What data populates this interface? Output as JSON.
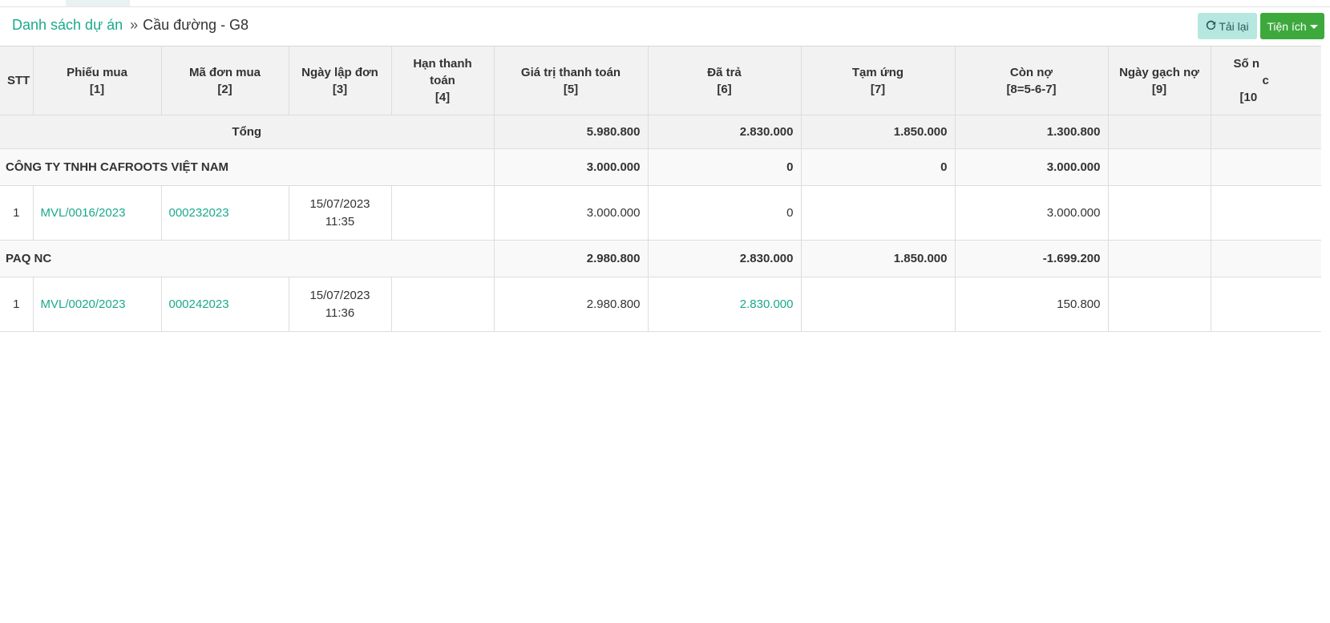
{
  "breadcrumb": {
    "parent": "Danh sách dự án",
    "separator": "»",
    "current": "Cầu đường - G8"
  },
  "toolbar": {
    "reload_label": "Tải lại",
    "utilities_label": "Tiện ích"
  },
  "table": {
    "headers": [
      {
        "title": "STT",
        "sub": ""
      },
      {
        "title": "Phiếu mua",
        "sub": "[1]"
      },
      {
        "title": "Mã đơn mua",
        "sub": "[2]"
      },
      {
        "title": "Ngày lập đơn",
        "sub": "[3]"
      },
      {
        "title": "Hạn thanh toán",
        "sub": "[4]"
      },
      {
        "title": "Giá trị thanh toán",
        "sub": "[5]"
      },
      {
        "title": "Đã trả",
        "sub": "[6]"
      },
      {
        "title": "Tạm ứng",
        "sub": "[7]"
      },
      {
        "title": "Còn nợ",
        "sub": "[8=5-6-7]"
      },
      {
        "title": "Ngày gạch nợ",
        "sub": "[9]"
      },
      {
        "title": "Số n",
        "sub": "c",
        "sub2": "[10"
      }
    ],
    "total": {
      "label": "Tổng",
      "value": "5.980.800",
      "paid": "2.830.000",
      "advance": "1.850.000",
      "debt": "1.300.800"
    },
    "groups": [
      {
        "name": "CÔNG TY TNHH CAFROOTS VIỆT NAM",
        "value": "3.000.000",
        "paid": "0",
        "advance": "0",
        "debt": "3.000.000",
        "rows": [
          {
            "stt": "1",
            "receipt": "MVL/0016/2023",
            "order_code": "000232023",
            "date": "15/07/2023",
            "time": "11:35",
            "due": "",
            "value": "3.000.000",
            "paid": "0",
            "advance": "",
            "debt": "3.000.000",
            "clear_date": ""
          }
        ]
      },
      {
        "name": "PAQ NC",
        "value": "2.980.800",
        "paid": "2.830.000",
        "advance": "1.850.000",
        "debt": "-1.699.200",
        "rows": [
          {
            "stt": "1",
            "receipt": "MVL/0020/2023",
            "order_code": "000242023",
            "date": "15/07/2023",
            "time": "11:36",
            "due": "",
            "value": "2.980.800",
            "paid": "2.830.000",
            "advance": "",
            "debt": "150.800",
            "clear_date": ""
          }
        ]
      }
    ]
  },
  "colors": {
    "link": "#1aaa8c",
    "reload_bg": "#b6e8e0",
    "utilities_bg": "#3da93d",
    "header_bg": "#f2f2f2"
  }
}
